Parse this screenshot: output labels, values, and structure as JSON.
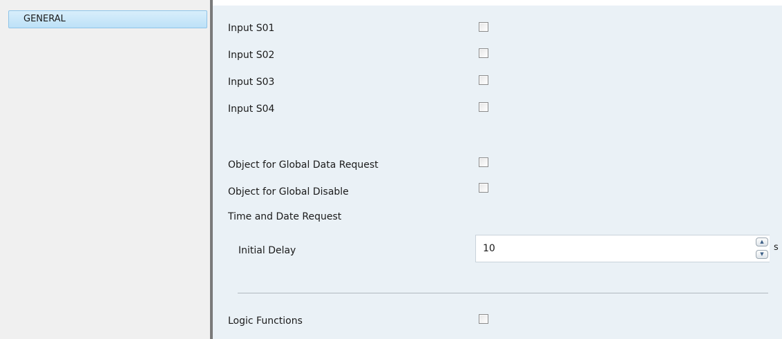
{
  "sidebar": {
    "items": [
      {
        "label": "GENERAL"
      }
    ]
  },
  "params": {
    "input_s01": "Input S01",
    "input_s02": "Input S02",
    "input_s03": "Input S03",
    "input_s04": "Input S04",
    "global_data_request": "Object for Global Data Request",
    "global_disable": "Object for Global Disable",
    "time_date_request": "Time and Date Request",
    "initial_delay": {
      "label": "Initial Delay",
      "value": "10",
      "unit": "s"
    },
    "logic_functions": "Logic Functions"
  },
  "icons": {
    "spin_up": "triangle-up",
    "spin_down": "triangle-down"
  },
  "colors": {
    "panel_bg": "#eaf1f6",
    "sidebar_bg": "#f0f0f0",
    "selected_item": "#bde1f7"
  }
}
